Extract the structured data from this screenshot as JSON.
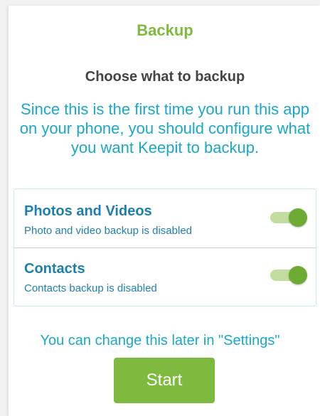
{
  "header": {
    "title": "Backup"
  },
  "main": {
    "subtitle": "Choose what to backup",
    "intro": "Since this is the first time you run this app on your phone, you should configure what you want Keepit to backup.",
    "options": [
      {
        "title": "Photos and Videos",
        "description": "Photo and video backup is disabled",
        "toggle_on": true
      },
      {
        "title": "Contacts",
        "description": "Contacts backup is disabled",
        "toggle_on": true
      }
    ],
    "settings_hint": "You can change this later in \"Settings\"",
    "start_label": "Start"
  },
  "colors": {
    "accent_green": "#7dba3e",
    "text_cyan": "#1aa8c9",
    "option_blue": "#1d7fae",
    "subtitle_gray": "#444444"
  },
  "icons": {
    "toggle": "switch-on"
  }
}
